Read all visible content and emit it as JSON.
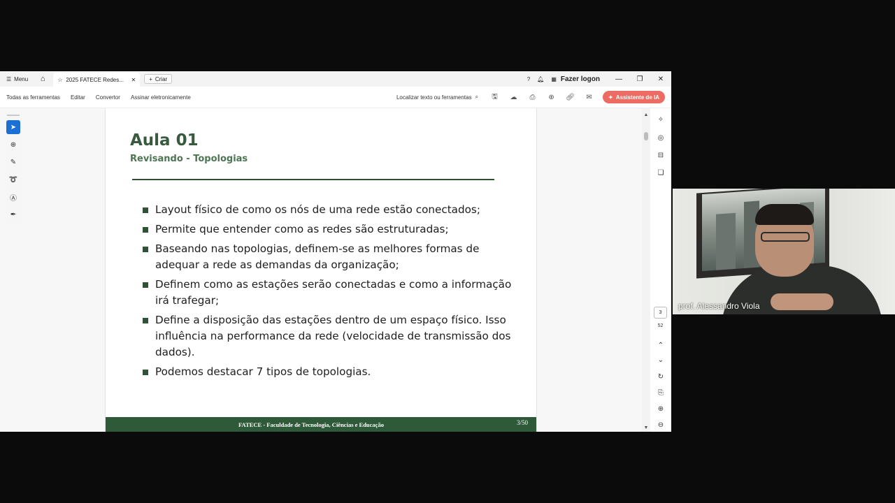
{
  "tabbar": {
    "menu_label": "Menu",
    "tab_title": "2025 FATECE Redes...",
    "create_label": "Criar",
    "login_label": "Fazer logon"
  },
  "toolbar": {
    "all_tools": "Todas as ferramentas",
    "edit": "Editar",
    "convert": "Convertor",
    "sign": "Assinar eletronicamente",
    "search_label": "Localizar texto ou ferramentas",
    "ai_assistant": "Assistente de IA"
  },
  "slide": {
    "title": "Aula 01",
    "subtitle": "Revisando - Topologias",
    "bullets": [
      "Layout físico de como os nós de uma rede estão conectados;",
      "Permite que entender como as redes são estruturadas;",
      "Baseando nas topologias, definem-se as melhores formas de adequar a rede as demandas da organização;",
      "Definem como as estações serão conectadas e como a informação irá trafegar;",
      "Define a disposição das estações dentro de um espaço físico.  Isso influência na performance da rede (velocidade de transmissão dos dados).",
      "Podemos destacar 7 tipos de topologias."
    ],
    "footer_text": "FATECE - Faculdade de Tecnologia, Ciências e Educação",
    "footer_page": "3/50"
  },
  "navigation": {
    "current_page": "3",
    "total_pages": "52"
  },
  "webcam": {
    "name": "prof. Alessandro Viola"
  },
  "colors": {
    "slide_title": "#3a5a3f",
    "slide_footer": "#2f5a3a",
    "ai_button": "#ec6b63",
    "active_tool": "#1c6fd3"
  }
}
